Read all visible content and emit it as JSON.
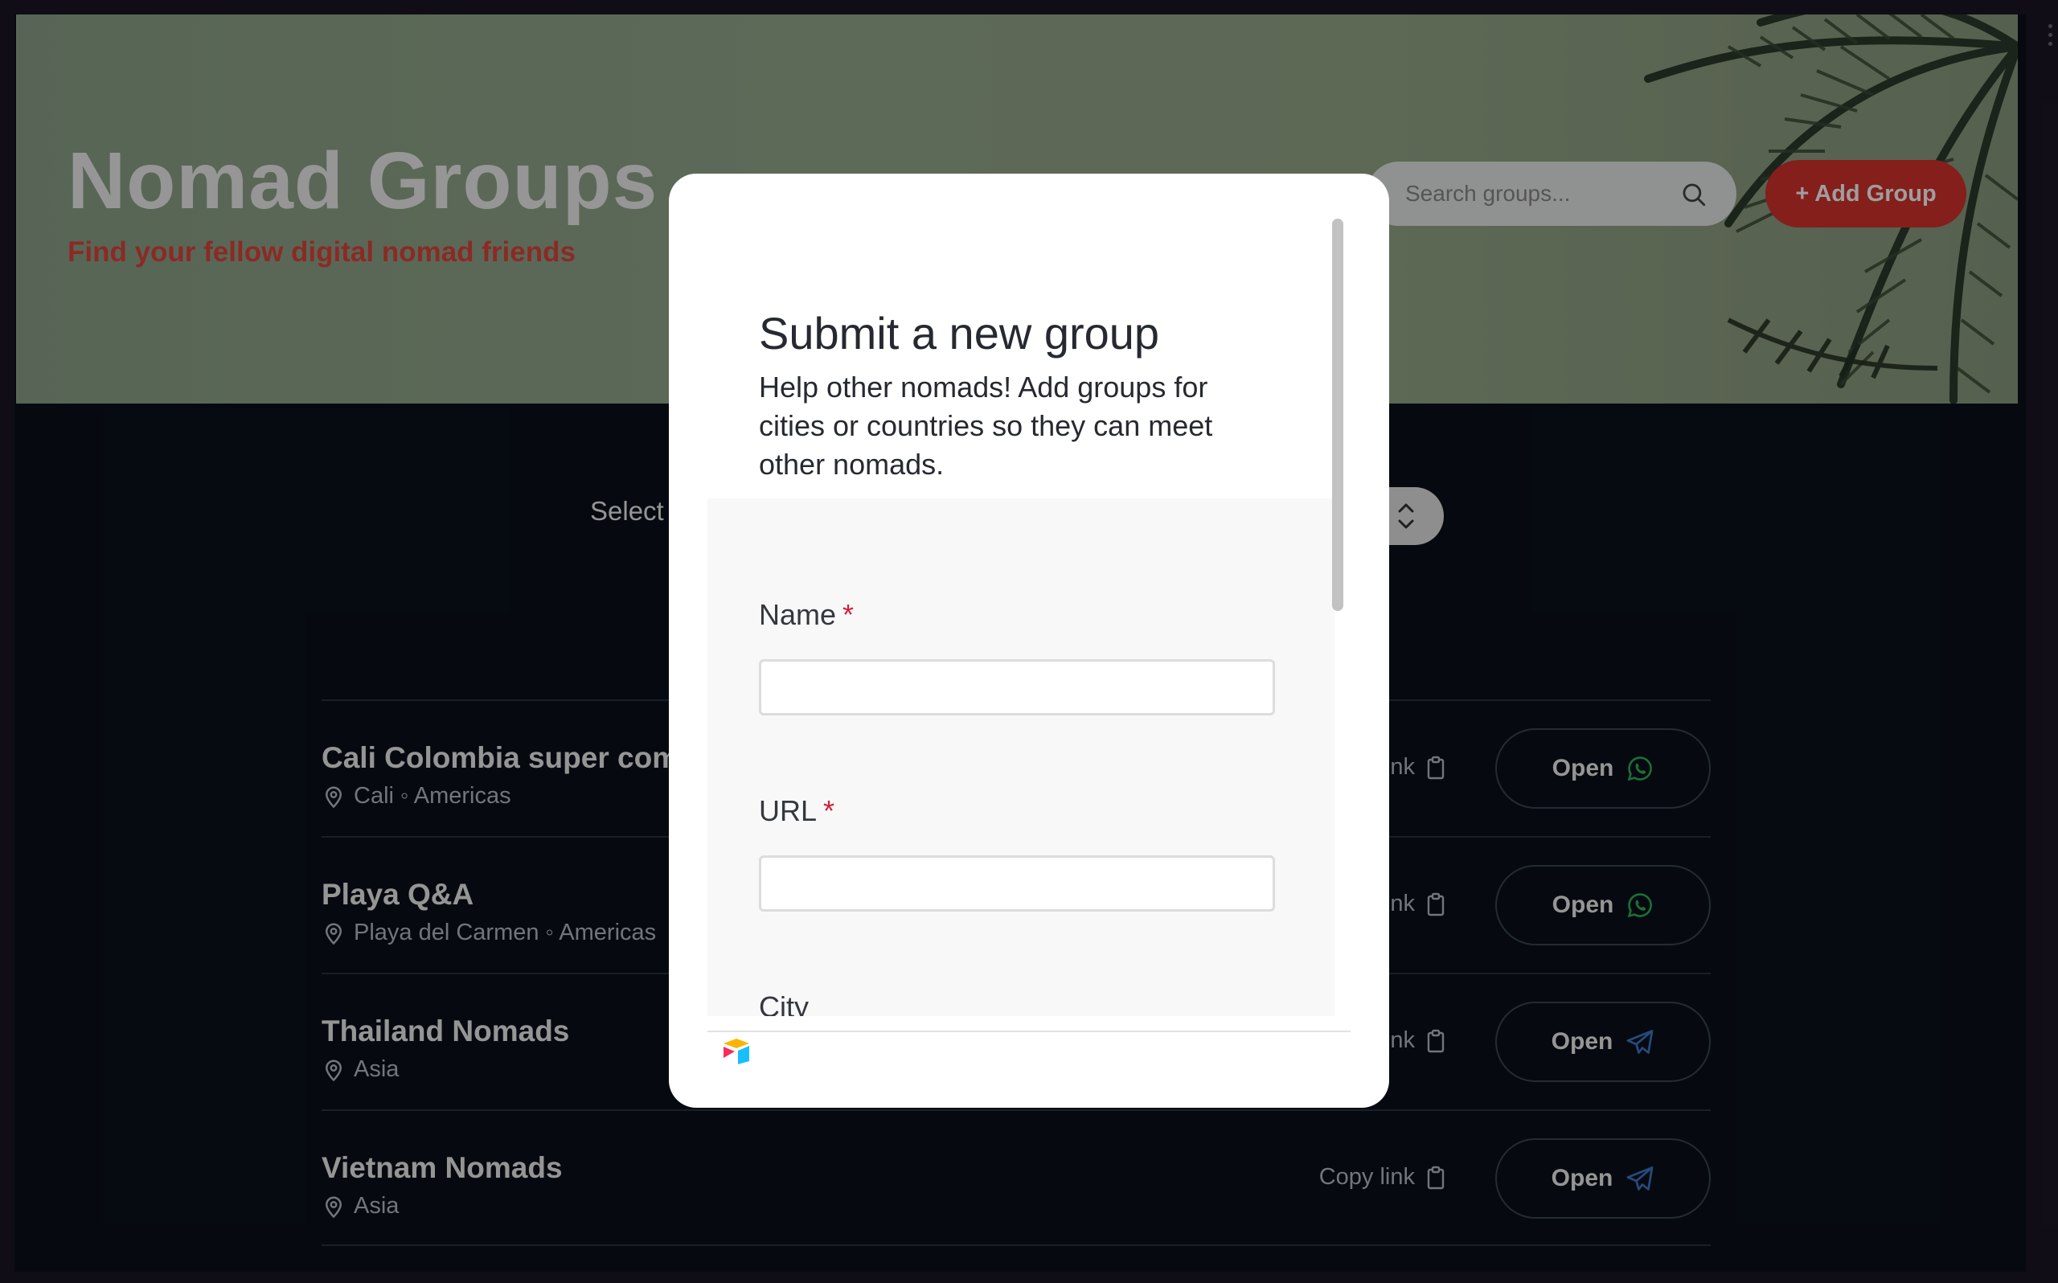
{
  "hero": {
    "title": "Nomad Groups",
    "subtitle": "Find your fellow digital nomad friends",
    "search_placeholder": "Search groups...",
    "add_group_label": "+ Add Group"
  },
  "filter": {
    "label_partial": "Select"
  },
  "groups": [
    {
      "title": "Cali Colombia super com",
      "meta": "Cali ◦ Americas",
      "copy": "nk",
      "open": "Open",
      "platform": "whatsapp"
    },
    {
      "title": "Playa Q&A",
      "meta": "Playa del Carmen ◦ Americas",
      "copy": "nk",
      "open": "Open",
      "platform": "whatsapp"
    },
    {
      "title": "Thailand Nomads",
      "meta": "Asia",
      "copy": "nk",
      "open": "Open",
      "platform": "telegram"
    },
    {
      "title": "Vietnam Nomads",
      "meta": "Asia",
      "copy": "Copy link",
      "open": "Open",
      "platform": "telegram"
    }
  ],
  "modal": {
    "title": "Submit a new group",
    "description": "Help other nomads! Add groups for cities or countries so they can meet other nomads.",
    "fields": [
      {
        "label": "Name",
        "required": "*"
      },
      {
        "label": "URL",
        "required": "*"
      },
      {
        "label": "City",
        "required": ""
      }
    ]
  },
  "colors": {
    "accent": "#d6332c",
    "subtitle": "#e0453d",
    "whatsapp": "#2fb35a",
    "telegram": "#3e78c9",
    "background": "#0a111b"
  }
}
